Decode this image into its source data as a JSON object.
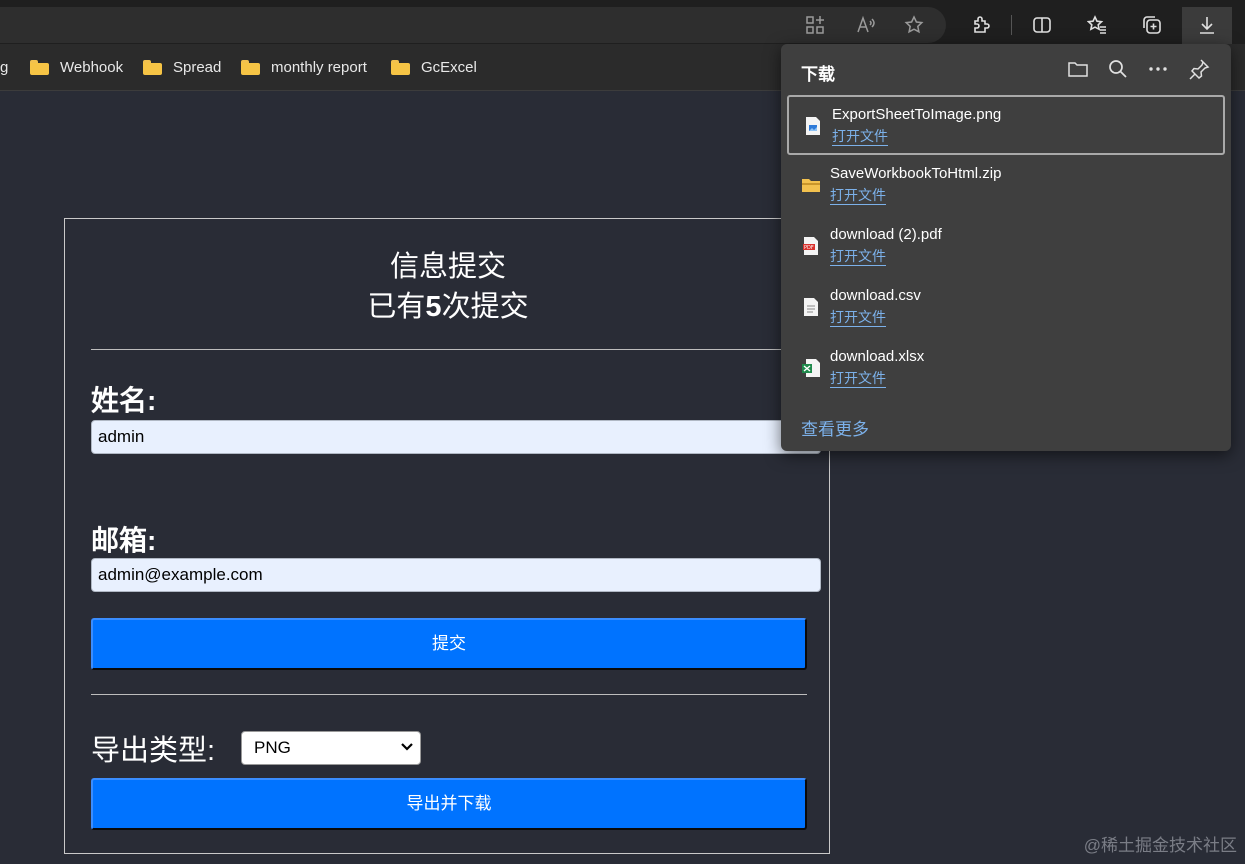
{
  "browser": {
    "bookmarks": [
      {
        "label": "g",
        "icon": "folder-icon"
      },
      {
        "label": "Webhook",
        "icon": "folder-icon"
      },
      {
        "label": "Spread",
        "icon": "folder-icon"
      },
      {
        "label": "monthly report",
        "icon": "folder-icon"
      },
      {
        "label": "GcExcel",
        "icon": "folder-icon"
      }
    ]
  },
  "form": {
    "title_line1": "信息提交",
    "title_line2_prefix": "已有",
    "submit_count": "5",
    "title_line2_suffix": "次提交",
    "name_label": "姓名:",
    "name_value": "admin",
    "email_label": "邮箱:",
    "email_value": "admin@example.com",
    "submit_button": "提交",
    "export_label": "导出类型:",
    "export_selected": "PNG",
    "export_button": "导出并下载"
  },
  "downloads": {
    "title": "下载",
    "items": [
      {
        "name": "ExportSheetToImage.png",
        "action": "打开文件",
        "icon": "image-file-icon",
        "icon_color": "#2f7ad8"
      },
      {
        "name": "SaveWorkbookToHtml.zip",
        "action": "打开文件",
        "icon": "zip-folder-icon",
        "icon_color": "#f2c14e"
      },
      {
        "name": "download (2).pdf",
        "action": "打开文件",
        "icon": "pdf-file-icon",
        "icon_color": "#d9302c"
      },
      {
        "name": "download.csv",
        "action": "打开文件",
        "icon": "text-file-icon",
        "icon_color": "#e8e8e8"
      },
      {
        "name": "download.xlsx",
        "action": "打开文件",
        "icon": "excel-file-icon",
        "icon_color": "#1f8a4c"
      }
    ],
    "see_more": "查看更多"
  },
  "watermark": "@稀土掘金技术社区"
}
